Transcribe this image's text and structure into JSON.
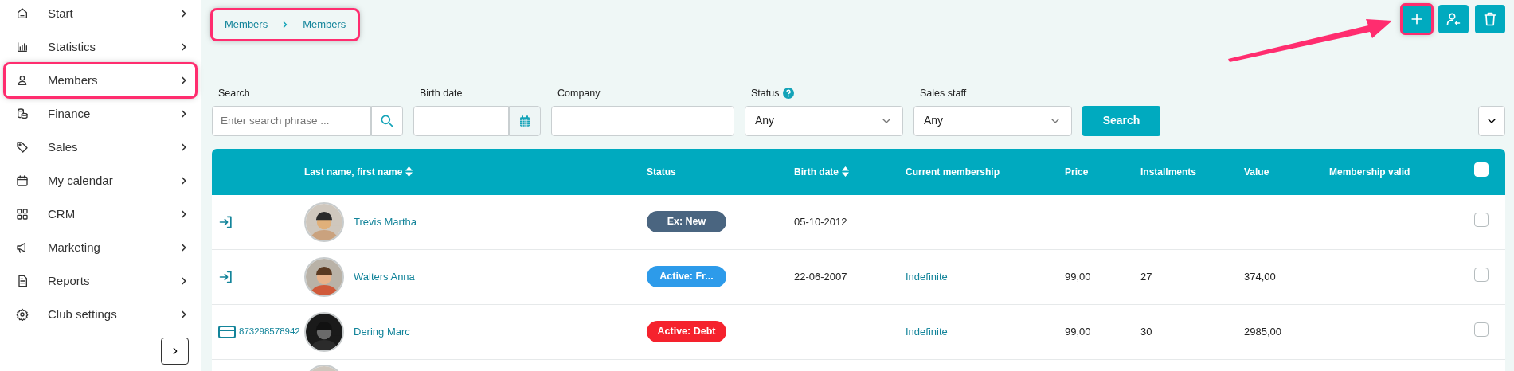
{
  "sidebar": {
    "items": [
      {
        "label": "Start",
        "highlighted": false
      },
      {
        "label": "Statistics",
        "highlighted": false
      },
      {
        "label": "Members",
        "highlighted": true
      },
      {
        "label": "Finance",
        "highlighted": false
      },
      {
        "label": "Sales",
        "highlighted": false
      },
      {
        "label": "My calendar",
        "highlighted": false
      },
      {
        "label": "CRM",
        "highlighted": false
      },
      {
        "label": "Marketing",
        "highlighted": false
      },
      {
        "label": "Reports",
        "highlighted": false
      },
      {
        "label": "Club settings",
        "highlighted": false
      }
    ]
  },
  "breadcrumb": {
    "items": [
      "Members",
      "Members"
    ],
    "highlighted": true
  },
  "toolbar": {
    "buttons": [
      {
        "kind": "add",
        "highlighted": true
      },
      {
        "kind": "assign",
        "highlighted": false
      },
      {
        "kind": "delete",
        "highlighted": false
      }
    ]
  },
  "filters": {
    "search": {
      "label": "Search",
      "placeholder": "Enter search phrase ..."
    },
    "birth_date": {
      "label": "Birth date"
    },
    "company": {
      "label": "Company"
    },
    "status": {
      "label": "Status",
      "value": "Any"
    },
    "sales_staff": {
      "label": "Sales staff",
      "value": "Any"
    },
    "search_button": "Search"
  },
  "table": {
    "columns": [
      {
        "label": "Last name, first name",
        "sortable": true
      },
      {
        "label": "Status",
        "sortable": false
      },
      {
        "label": "Birth date",
        "sortable": true
      },
      {
        "label": "Current membership",
        "sortable": false
      },
      {
        "label": "Price",
        "sortable": false
      },
      {
        "label": "Installments",
        "sortable": false
      },
      {
        "label": "Value",
        "sortable": false
      },
      {
        "label": "Membership valid",
        "sortable": false
      }
    ],
    "select_all": {
      "checked": false
    },
    "rows": [
      {
        "kind": "member",
        "entry": {
          "kind": "login"
        },
        "name": "Trevis Martha",
        "status": {
          "label": "Ex: New",
          "color": "#4a6580"
        },
        "birth_date": "05-10-2012",
        "checked": false
      },
      {
        "kind": "member",
        "entry": {
          "kind": "login"
        },
        "name": "Walters Anna",
        "status": {
          "label": "Active: Fr...",
          "color": "#2d9bea"
        },
        "birth_date": "22-06-2007",
        "membership": "Indefinite",
        "price": "99,00",
        "installments": "27",
        "value": "374,00",
        "checked": false
      },
      {
        "kind": "member",
        "entry": {
          "kind": "card"
        },
        "card_number": "873298578942",
        "name": "Dering Marc",
        "status": {
          "label": "Active: Debt",
          "color": "#f5222d"
        },
        "membership": "Indefinite",
        "price": "99,00",
        "installments": "30",
        "value": "2985,00",
        "checked": false
      },
      {
        "kind": "cut-off"
      }
    ]
  }
}
